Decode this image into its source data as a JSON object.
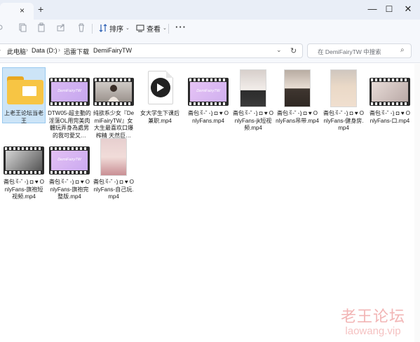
{
  "window": {
    "tab_close": "×",
    "new_tab": "+",
    "minimize": "—",
    "maximize": "☐",
    "close": "✕"
  },
  "toolbar": {
    "sort_label": "排序",
    "view_label": "查看",
    "more": "···"
  },
  "address": {
    "crumbs": [
      "此电脑",
      "Data (D:)",
      "迅雷下载",
      "DemiFairyTW"
    ]
  },
  "search": {
    "placeholder": "在 DemiFairyTW 中搜索"
  },
  "files": [
    {
      "name": "上老王论坛当老王",
      "type": "folder"
    },
    {
      "name": "DTW05-超主動的淫蕩OL用完美肉體玩弄身為處男的我可愛又…",
      "type": "video-pink"
    },
    {
      "name": "纯欲系少女『DemiFairyTW』女大生最喜欢口爆榨精 天然巨…",
      "type": "video-photo"
    },
    {
      "name": "女大学生下课后兼职.mp4",
      "type": "mp4-file"
    },
    {
      "name": "斋包ꉂ-˘ -)ِ ◘ ♥ OnlyFans.mp4",
      "type": "video-pink"
    },
    {
      "name": "斋包ꉂ-˘ -)ِ ◘ ♥ OnlyFans-jk短视频.mp4",
      "type": "portrait-1"
    },
    {
      "name": "斋包ꉂ-˘ -)ِ ◘ ♥ OnlyFans吊带.mp4",
      "type": "portrait-2"
    },
    {
      "name": "斋包ꉂ-˘ -)ِ ◘ ♥ OnlyFans-健身房.mp4",
      "type": "portrait-3"
    },
    {
      "name": "斋包ꉂ-˘ -)ِ ◘ ♥ OnlyFans-口.mp4",
      "type": "video-photo2"
    },
    {
      "name": "斋包ꉂ-˘ -)ِ ◘ ♥ OnlyFans-旗袍短视频.mp4",
      "type": "video-photo3"
    },
    {
      "name": "斋包ꉂ-˘ -)ِ ◘ ♥ OnlyFans-旗袍完整版.mp4",
      "type": "video-pink"
    },
    {
      "name": "斋包ꉂ-˘ -)ِ ◘ ♥ OnlyFans-自己玩.mp4",
      "type": "portrait-4"
    }
  ],
  "frame_caption": "DemiFairyTW",
  "watermark": {
    "cn": "老王论坛",
    "en": "laowang.vip"
  }
}
